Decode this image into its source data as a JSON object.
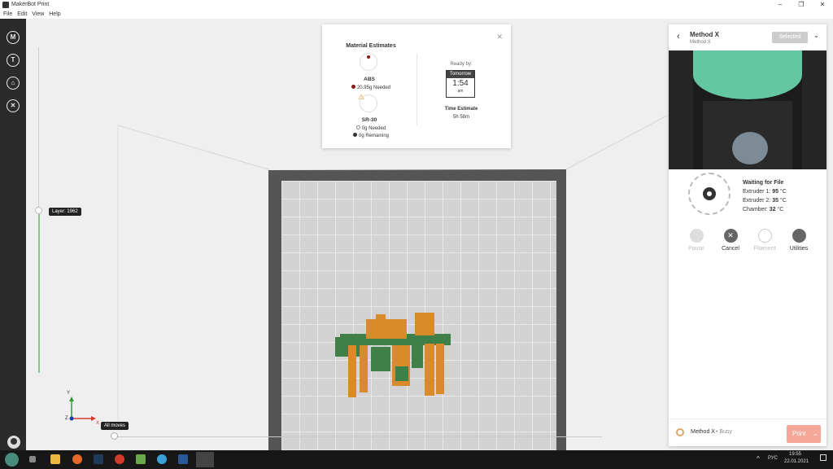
{
  "app": {
    "title": "MakerBot Print"
  },
  "menu": [
    "File",
    "Edit",
    "View",
    "Help"
  ],
  "left_toolbar": [
    {
      "label": "M",
      "icon": "makerbot-logo-icon"
    },
    {
      "label": "T",
      "icon": "thingiverse-icon"
    },
    {
      "label": "",
      "icon": "store-cart-icon"
    },
    {
      "label": "",
      "icon": "tools-icon"
    }
  ],
  "viewport": {
    "layer_label": "Layer: 1962",
    "moves_label": "All moves",
    "axis_labels": {
      "x": "X",
      "y": "Y",
      "z": "Z"
    }
  },
  "estimates": {
    "title": "Material Estimates",
    "abs_name": "ABS",
    "abs_needed": "20.95g  Needed",
    "sr_name": "SR-30",
    "sr_needed": "0g  Needed",
    "sr_remaining": "0g  Remaining",
    "ready_label": "Ready by:",
    "ready_day": "Tomorrow",
    "ready_time": "1:54",
    "ready_ampm": "am",
    "time_label": "Time Estimate",
    "time_value": "5h 58m"
  },
  "printer": {
    "name": "Method X",
    "subname": "Method X",
    "selected_label": "Selected",
    "status_title": "Waiting for File",
    "ext1_label": "Extruder 1: ",
    "ext1_value": "95",
    "ext2_label": "Extruder 2: ",
    "ext2_value": "35",
    "chamber_label": "Chamber: ",
    "chamber_value": "32",
    "unit": " °C",
    "actions": {
      "pause": "Pause",
      "cancel": "Cancel",
      "filament": "Filament",
      "utilities": "Utilities"
    },
    "footer_name": "Method X",
    "footer_status": "• Busy",
    "print_label": "Print"
  },
  "taskbar": {
    "lang": "РУС",
    "time": "19:55",
    "date": "22.01.2021"
  },
  "colors": {
    "accent_green": "#8bc58b",
    "print_button": "#f6a79a",
    "model_orange": "#d98a2b",
    "model_green": "#3f7f48"
  }
}
